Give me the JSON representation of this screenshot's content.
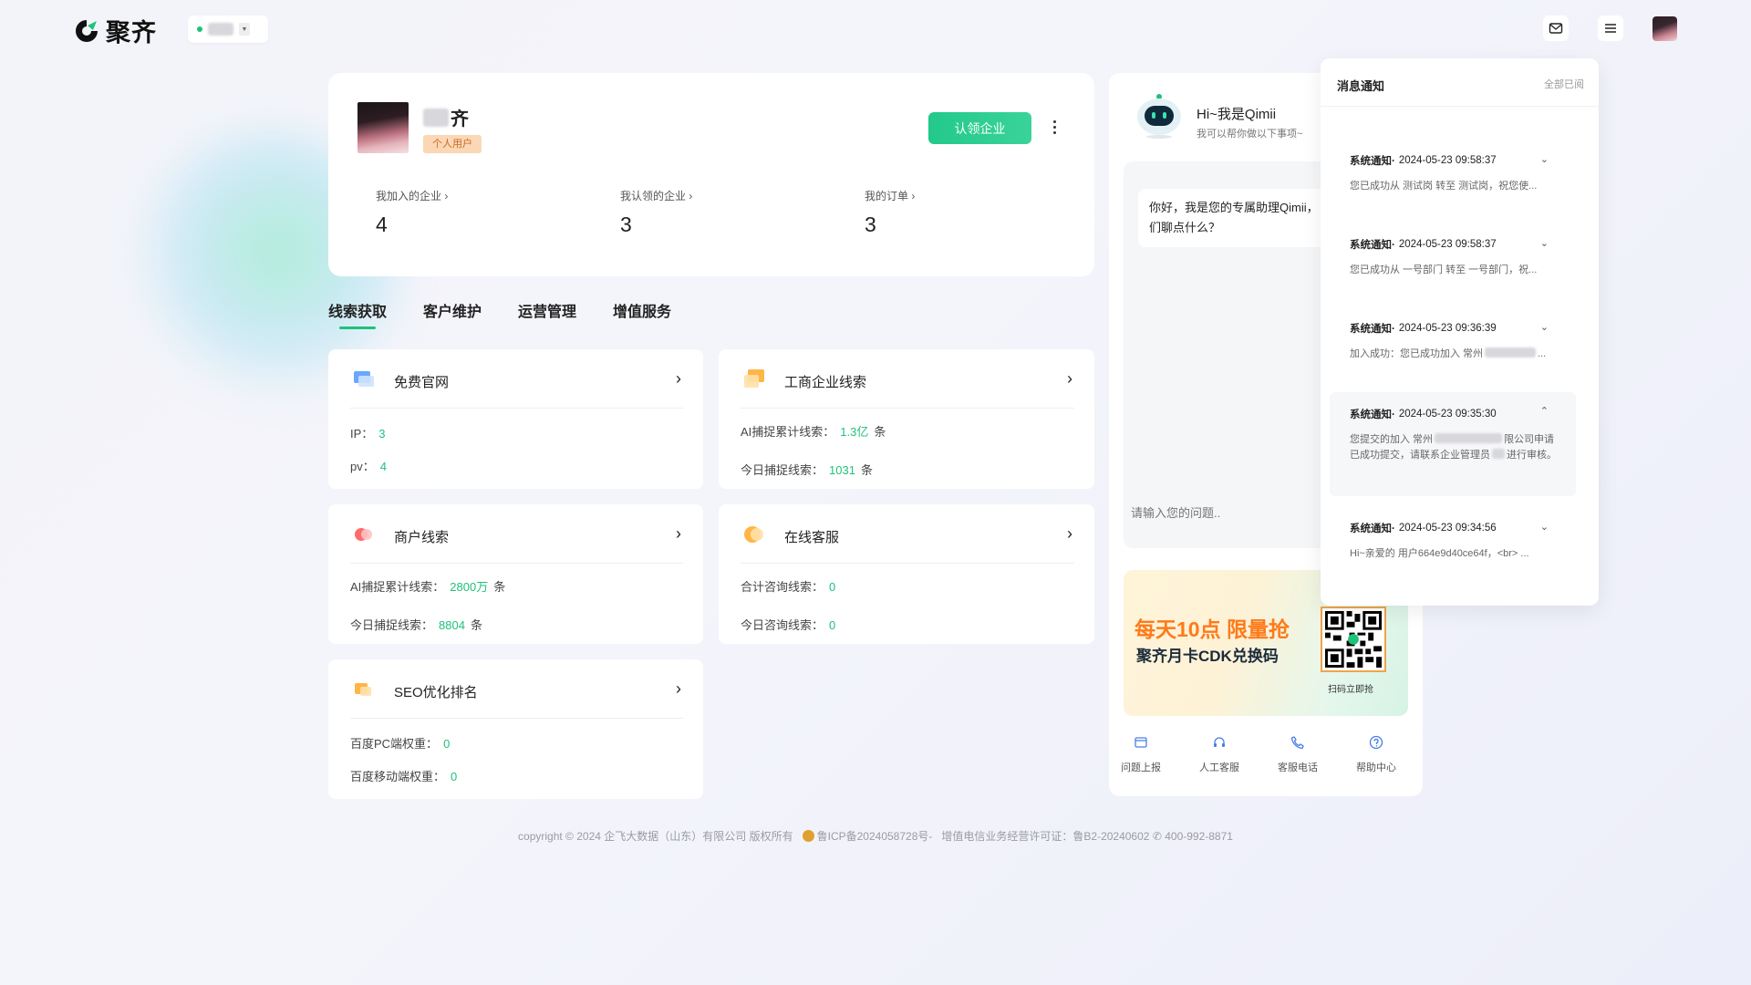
{
  "brand": {
    "name": "聚齐",
    "color": "#1ec27a"
  },
  "header": {
    "enterprise_selector": {
      "status": "online",
      "icon": "caret-icon"
    },
    "mail_icon": "mail-icon",
    "menu_icon": "menu-icon"
  },
  "profile": {
    "name_suffix": "齐",
    "badge": "个人用户",
    "claim_button": "认领企业",
    "stats": [
      {
        "label": "我加入的企业",
        "value": "4"
      },
      {
        "label": "我认领的企业",
        "value": "3"
      },
      {
        "label": "我的订单",
        "value": "3"
      }
    ]
  },
  "tabs": [
    "线索获取",
    "客户维护",
    "运营管理",
    "增值服务"
  ],
  "features": {
    "official": {
      "title": "免费官网",
      "rows": [
        {
          "label": "IP：",
          "value": "3"
        },
        {
          "label": "pv：",
          "value": "4"
        }
      ]
    },
    "business": {
      "title": "工商企业线索",
      "rows": [
        {
          "label": "AI捕捉累计线索：",
          "value": "1.3亿",
          "unit": "条"
        },
        {
          "label": "今日捕捉线索：",
          "value": "1031",
          "unit": "条"
        }
      ]
    },
    "merchant": {
      "title": "商户线索",
      "rows": [
        {
          "label": "AI捕捉累计线索：",
          "value": "2800万",
          "unit": "条"
        },
        {
          "label": "今日捕捉线索：",
          "value": "8804",
          "unit": "条"
        }
      ]
    },
    "service": {
      "title": "在线客服",
      "rows": [
        {
          "label": "合计咨询线索：",
          "value": "0"
        },
        {
          "label": "今日咨询线索：",
          "value": "0"
        }
      ]
    },
    "seo": {
      "title": "SEO优化排名",
      "rows": [
        {
          "label": "百度PC端权重：",
          "value": "0"
        },
        {
          "label": "百度移动端权重：",
          "value": "0"
        }
      ]
    }
  },
  "assistant": {
    "title": "Hi~我是Qimii",
    "subtitle": "我可以帮你做以下事项~",
    "message": "你好，我是您的专属助理Qimii，们聊点什么？",
    "input_placeholder": "请输入您的问题..",
    "promo": {
      "headline": "每天10点 限量抢",
      "sub": "聚齐月卡CDK兑换码",
      "qr_label": "扫码立即抢"
    },
    "footer": [
      {
        "label": "问题上报",
        "icon": "report-icon"
      },
      {
        "label": "人工客服",
        "icon": "headset-icon"
      },
      {
        "label": "客服电话",
        "icon": "phone-icon"
      },
      {
        "label": "帮助中心",
        "icon": "help-icon"
      }
    ]
  },
  "notifications": {
    "title": "消息通知",
    "mark_all": "全部已阅",
    "items": [
      {
        "type": "系统通知·",
        "time": "2024-05-23 09:58:37",
        "text": "您已成功从 测试岗 转至 测试岗，祝您使...",
        "expanded": false
      },
      {
        "type": "系统通知·",
        "time": "2024-05-23 09:58:37",
        "text": "您已成功从 一号部门 转至 一号部门，祝...",
        "expanded": false
      },
      {
        "type": "系统通知·",
        "time": "2024-05-23 09:36:39",
        "text": "加入成功：您已成功加入 常州",
        "text_tail": "...",
        "expanded": false
      },
      {
        "type": "系统通知·",
        "time": "2024-05-23 09:35:30",
        "text": "您提交的加入 常州",
        "text_mid": "限公司申请已成功提交，请联系企业管理员",
        "text_tail": "进行审核。",
        "expanded": true
      },
      {
        "type": "系统通知·",
        "time": "2024-05-23 09:34:56",
        "text": "Hi~亲爱的 用户664e9d40ce64f，<br> ...",
        "expanded": false
      }
    ]
  },
  "footer": {
    "copyright": "copyright © 2024 企飞大数据（山东）有限公司 版权所有",
    "icp": "鲁ICP备2024058728号-",
    "license": "增值电信业务经营许可证：鲁B2-20240602",
    "phone": "400-992-8871"
  }
}
